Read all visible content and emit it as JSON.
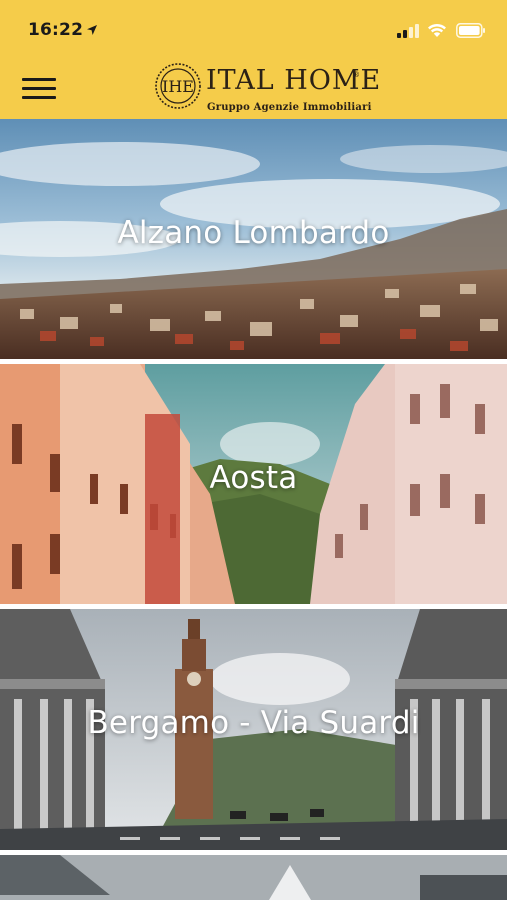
{
  "status_bar": {
    "time": "16:22",
    "icons": [
      "location-arrow-icon",
      "signal-icon",
      "wifi-icon",
      "battery-icon"
    ]
  },
  "header": {
    "menu_icon": "hamburger-menu-icon",
    "brand": {
      "emblem_text": "IHE",
      "name": "ITAL HOME",
      "tagline": "Gruppo Agenzie Immobiliari"
    },
    "background_color": "#f5cc4a"
  },
  "cities": [
    {
      "name": "Alzano Lombardo"
    },
    {
      "name": "Aosta"
    },
    {
      "name": "Bergamo - Via Suardi"
    },
    {
      "name": ""
    }
  ]
}
